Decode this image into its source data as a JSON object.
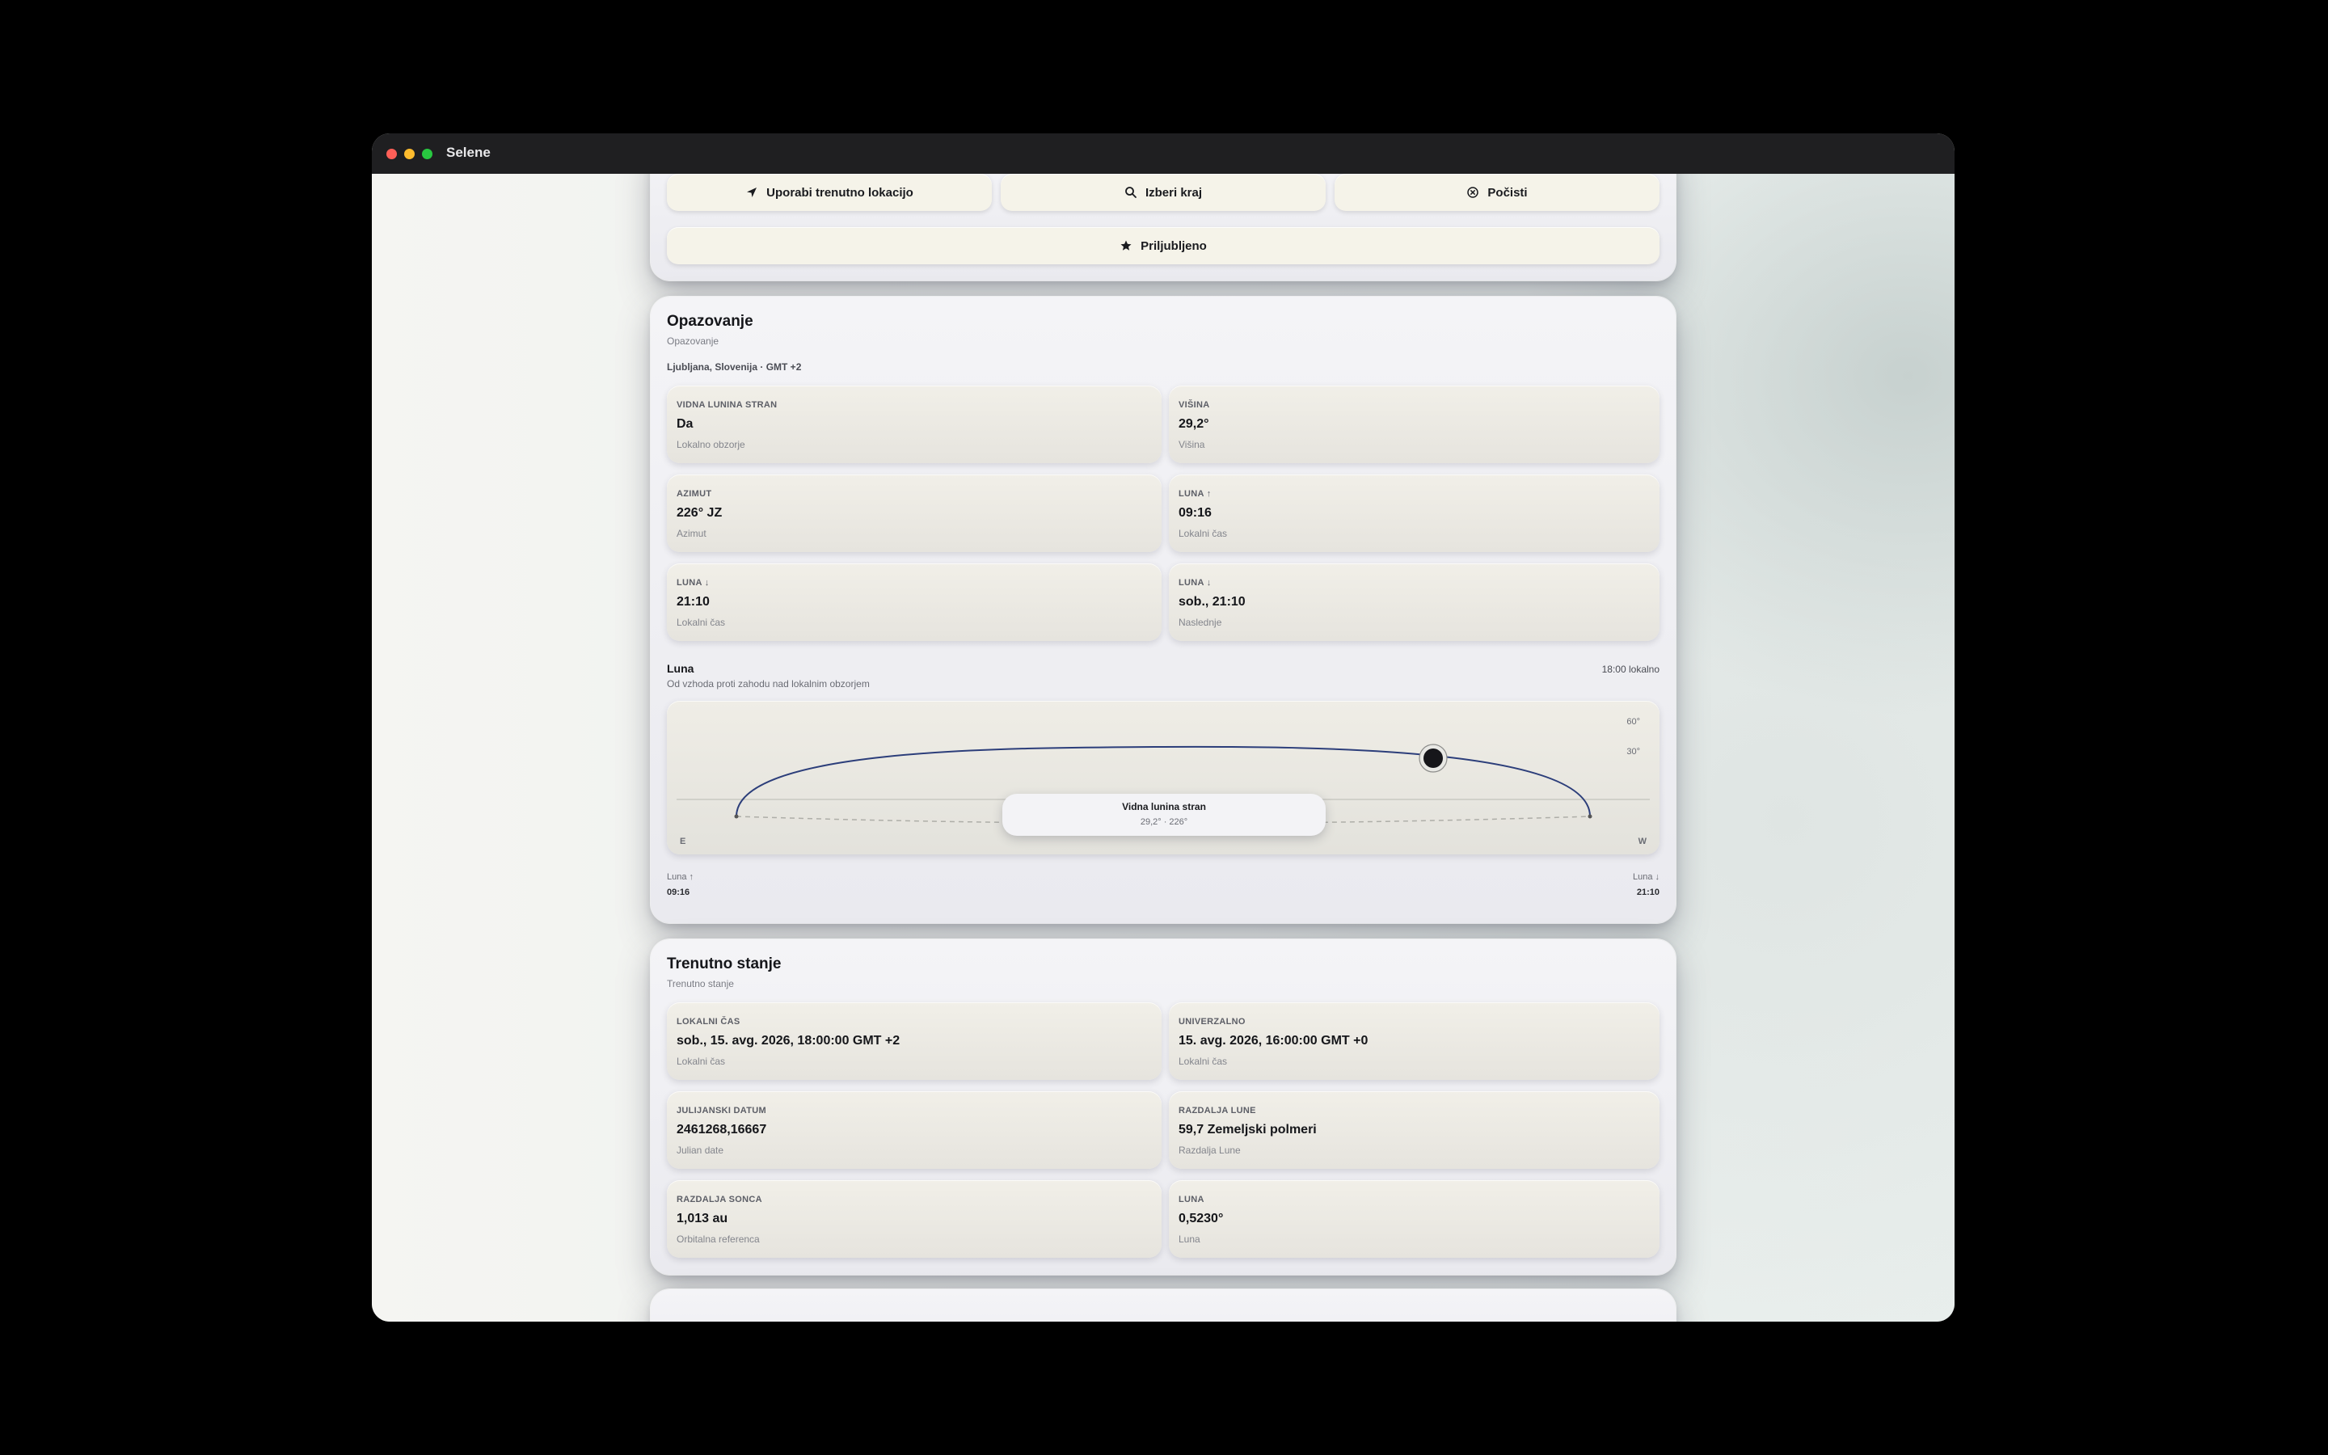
{
  "window": {
    "title": "Selene"
  },
  "location_panel": {
    "buttons": {
      "current_location": "Uporabi trenutno lokacijo",
      "choose_place": "Izberi kraj",
      "clear": "Počisti",
      "favorites": "Priljubljeno"
    }
  },
  "observation": {
    "title": "Opazovanje",
    "subtitle": "Opazovanje",
    "location": "Ljubljana, Slovenija · GMT +2",
    "cards": [
      {
        "label": "VIDNA LUNINA STRAN",
        "value": "Da",
        "note": "Lokalno obzorje"
      },
      {
        "label": "VIŠINA",
        "value": "29,2°",
        "note": "Višina"
      },
      {
        "label": "AZIMUT",
        "value": "226° JZ",
        "note": "Azimut"
      },
      {
        "label": "LUNA ↑",
        "value": "09:16",
        "note": "Lokalni čas"
      },
      {
        "label": "LUNA ↓",
        "value": "21:10",
        "note": "Lokalni čas"
      },
      {
        "label": "LUNA ↓",
        "value": "sob., 21:10",
        "note": "Naslednje"
      }
    ],
    "path": {
      "title": "Luna",
      "subtitle": "Od vzhoda proti zahodu nad lokalnim obzorjem",
      "time_label": "18:00 lokalno",
      "scale_labels": [
        "60°",
        "30°"
      ],
      "east_label": "E",
      "west_label": "W",
      "rise_label": "Luna ↑",
      "rise_time": "09:16",
      "set_label": "Luna ↓",
      "set_time": "21:10",
      "status_title": "Vidna lunina stran",
      "status_detail": "29,2° · 226°"
    }
  },
  "current_state": {
    "title": "Trenutno stanje",
    "subtitle": "Trenutno stanje",
    "cards": [
      {
        "label": "LOKALNI ČAS",
        "value": "sob., 15. avg. 2026, 18:00:00 GMT +2",
        "note": "Lokalni čas"
      },
      {
        "label": "UNIVERZALNO",
        "value": "15. avg. 2026, 16:00:00 GMT +0",
        "note": "Lokalni čas"
      },
      {
        "label": "JULIJANSKI DATUM",
        "value": "2461268,16667",
        "note": "Julian date"
      },
      {
        "label": "RAZDALJA LUNE",
        "value": "59,7 Zemeljski polmeri",
        "note": "Razdalja Lune"
      },
      {
        "label": "RAZDALJA SONCA",
        "value": "1,013 au",
        "note": "Orbitalna referenca"
      },
      {
        "label": "LUNA",
        "value": "0,5230°",
        "note": "Luna"
      }
    ]
  },
  "colors": {
    "accent_path": "#2c3e7a",
    "button_bg": "#f5f3e9",
    "card_bg": "#ece9e2"
  }
}
